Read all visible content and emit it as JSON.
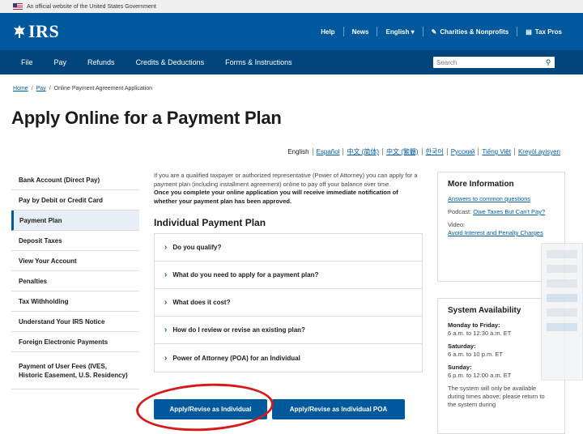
{
  "gov_banner": {
    "text": "An official website of the United States Government"
  },
  "header": {
    "logo": "IRS",
    "utility": [
      {
        "label": "Help"
      },
      {
        "label": "News"
      },
      {
        "label": "English"
      },
      {
        "label": "Charities & Nonprofits"
      },
      {
        "label": "Tax Pros"
      }
    ]
  },
  "nav": {
    "items": [
      "File",
      "Pay",
      "Refunds",
      "Credits & Deductions",
      "Forms & Instructions"
    ],
    "search_placeholder": "Search"
  },
  "breadcrumb": {
    "home": "Home",
    "pay": "Pay",
    "current": "Online Payment Agreement Application"
  },
  "page_title": "Apply Online for a Payment Plan",
  "languages": [
    "English",
    "Español",
    "中文 (简体)",
    "中文 (繁體)",
    "한국어",
    "Русский",
    "Tiếng Việt",
    "Kreyòl ayisyen"
  ],
  "sidebar": {
    "items": [
      "Bank Account (Direct Pay)",
      "Pay by Debit or Credit Card",
      "Payment Plan",
      "Deposit Taxes",
      "View Your Account",
      "Penalties",
      "Tax Withholding",
      "Understand Your IRS Notice",
      "Foreign Electronic Payments",
      "Payment of User Fees (IVES, Historic Easement, U.S. Residency)"
    ],
    "active_index": 2
  },
  "main": {
    "intro": "If you are a qualified taxpayer or authorized representative (Power of Attorney) you can apply for a payment plan (including installment agreement) online to pay off your balance over time.",
    "intro_bold": "Once you complete your online application you will receive immediate notification of whether your payment plan has been approved.",
    "section_title": "Individual Payment Plan",
    "accordion": [
      "Do you qualify?",
      "What do you need to apply for a payment plan?",
      "What does it cost?",
      "How do I review or revise an existing plan?",
      "Power of Attorney (POA) for an Individual"
    ],
    "buttons": {
      "individual": "Apply/Revise as Individual",
      "poa": "Apply/Revise as Individual POA"
    }
  },
  "more_info": {
    "title": "More Information",
    "link1": "Answers to common questions",
    "podcast_label": "Podcast:",
    "podcast_link": "Owe Taxes But Can't Pay?",
    "video_label": "Video:",
    "video_link": "Avoid Interest and Penalty Charges"
  },
  "availability": {
    "title": "System Availability",
    "rows": [
      {
        "day": "Monday to Friday:",
        "hours": "6 a.m. to 12:30 a.m. ET"
      },
      {
        "day": "Saturday:",
        "hours": "6 a.m. to 10 p.m. ET"
      },
      {
        "day": "Sunday:",
        "hours": "6 p.m. to 12:00 a.m. ET"
      }
    ],
    "note": "The system will only be available during times above; please return to the system during"
  },
  "colors": {
    "header": "#00599c",
    "nav": "#00457c",
    "button": "#00599c",
    "annotation": "#d81919"
  }
}
